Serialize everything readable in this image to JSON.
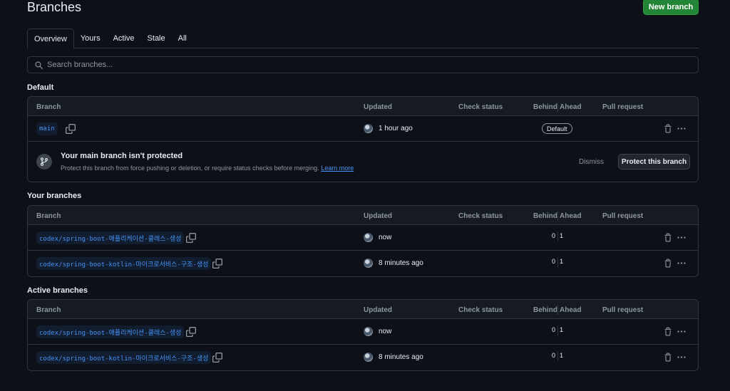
{
  "header": {
    "title": "Branches",
    "new_branch_label": "New branch"
  },
  "tabs": [
    {
      "label": "Overview",
      "active": true
    },
    {
      "label": "Yours",
      "active": false
    },
    {
      "label": "Active",
      "active": false
    },
    {
      "label": "Stale",
      "active": false
    },
    {
      "label": "All",
      "active": false
    }
  ],
  "search": {
    "placeholder": "Search branches..."
  },
  "columns": {
    "branch": "Branch",
    "updated": "Updated",
    "check_status": "Check status",
    "behind": "Behind",
    "ahead": "Ahead",
    "pull_request": "Pull request"
  },
  "default_section": {
    "title": "Default",
    "branch": {
      "name": "main",
      "updated": "1 hour ago",
      "badge": "Default"
    },
    "protection": {
      "title": "Your main branch isn't protected",
      "description": "Protect this branch from force pushing or deletion, or require status checks before merging.",
      "learn_more": "Learn more",
      "dismiss": "Dismiss",
      "protect_label": "Protect this branch"
    }
  },
  "your_section": {
    "title": "Your branches",
    "rows": [
      {
        "name": "codex/spring-boot-애플리케이션-클래스-생성",
        "updated": "now",
        "behind": "0",
        "ahead": "1"
      },
      {
        "name": "codex/spring-boot-kotlin-마이크로서비스-구조-생성",
        "updated": "8 minutes ago",
        "behind": "0",
        "ahead": "1"
      }
    ]
  },
  "active_section": {
    "title": "Active branches",
    "rows": [
      {
        "name": "codex/spring-boot-애플리케이션-클래스-생성",
        "updated": "now",
        "behind": "0",
        "ahead": "1"
      },
      {
        "name": "codex/spring-boot-kotlin-마이크로서비스-구조-생성",
        "updated": "8 minutes ago",
        "behind": "0",
        "ahead": "1"
      }
    ]
  },
  "colors": {
    "accent": "#238636",
    "link": "#4493f8",
    "background": "#0d1117",
    "border": "#30363d"
  }
}
